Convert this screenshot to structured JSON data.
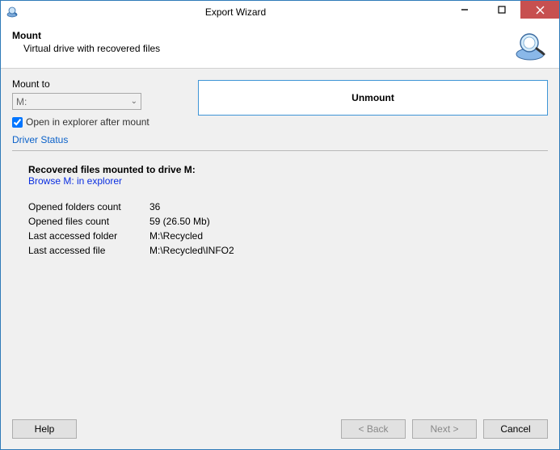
{
  "titlebar": {
    "title": "Export Wizard"
  },
  "header": {
    "title": "Mount",
    "subtitle": "Virtual drive with recovered files"
  },
  "mount": {
    "label": "Mount to",
    "drive": "M:",
    "checkbox_label": "Open in explorer after mount",
    "checkbox_checked": true,
    "unmount_label": "Unmount",
    "driver_status": "Driver Status"
  },
  "info": {
    "title": "Recovered files mounted to drive M:",
    "browse_label": "Browse M: in explorer",
    "rows": [
      {
        "key": "Opened folders count",
        "val": "36"
      },
      {
        "key": "Opened files count",
        "val": "59 (26.50 Mb)"
      },
      {
        "key": "Last accessed folder",
        "val": "M:\\Recycled"
      },
      {
        "key": "Last accessed file",
        "val": "M:\\Recycled\\INFO2"
      }
    ]
  },
  "footer": {
    "help": "Help",
    "back": "< Back",
    "next": "Next >",
    "cancel": "Cancel"
  }
}
